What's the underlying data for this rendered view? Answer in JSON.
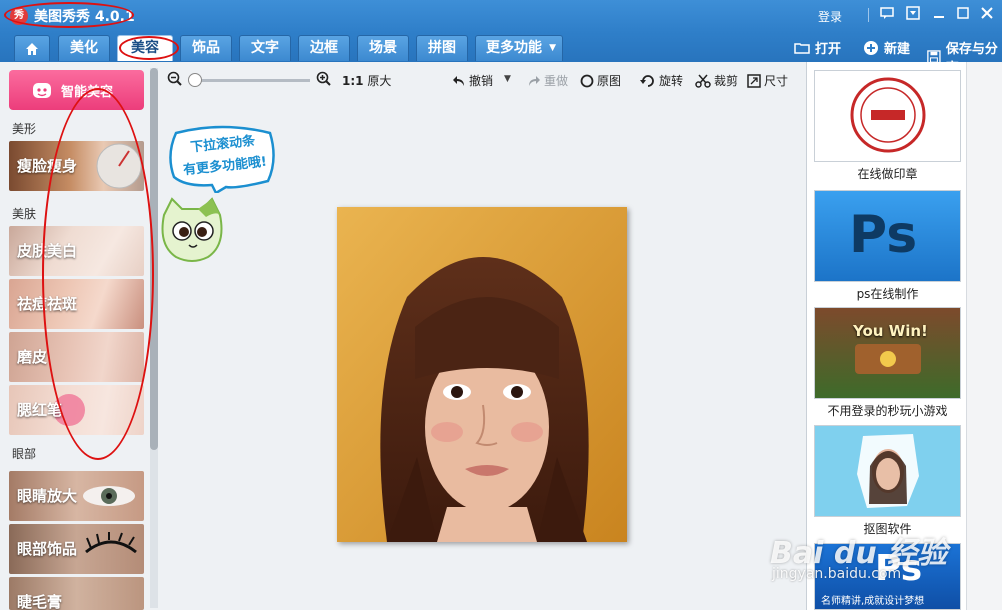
{
  "app": {
    "logo_text": "秀",
    "title": "美图秀秀 4.0.1",
    "login": "登录"
  },
  "tabs": [
    {
      "label": "",
      "icon": "home-icon"
    },
    {
      "label": "美化"
    },
    {
      "label": "美容"
    },
    {
      "label": "饰品"
    },
    {
      "label": "文字"
    },
    {
      "label": "边框"
    },
    {
      "label": "场景"
    },
    {
      "label": "拼图"
    },
    {
      "label": "更多功能"
    }
  ],
  "actions": {
    "open": "打开",
    "new": "新建",
    "save": "保存与分享"
  },
  "left_panel": {
    "smart_button": "智能美容",
    "categories": {
      "shape": "美形",
      "skin": "美肤",
      "eye": "眼部"
    },
    "features": [
      "瘦脸瘦身",
      "皮肤美白",
      "祛痘祛斑",
      "磨皮",
      "腮红笔",
      "眼睛放大",
      "眼部饰品",
      "睫毛膏"
    ]
  },
  "toolbar": {
    "ratio_num": "1:1",
    "ratio_label": "原大",
    "undo": "撤销",
    "redo": "重做",
    "original": "原图",
    "rotate": "旋转",
    "crop": "裁剪",
    "size": "尺寸"
  },
  "mascot": {
    "line1": "下拉滚动条",
    "line2": "有更多功能哦!"
  },
  "right_panel": {
    "ads": [
      {
        "caption": "在线做印章"
      },
      {
        "caption": "ps在线制作",
        "thumb_text": "Ps"
      },
      {
        "caption": "不用登录的秒玩小游戏",
        "thumb_text": "You Win!"
      },
      {
        "caption": "抠图软件"
      },
      {
        "caption": "名师精讲,成就设计梦想",
        "thumb_text": "Ps"
      }
    ]
  },
  "watermark": {
    "main": "Bai du 经验",
    "sub": "jingyan.baidu.com"
  }
}
